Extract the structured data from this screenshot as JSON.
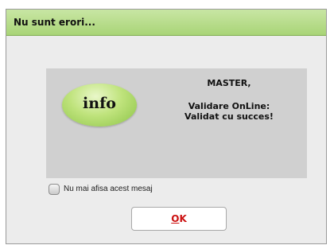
{
  "dialog": {
    "title": "Nu sunt erori...",
    "info_label": "info",
    "message": {
      "user": "MASTER,",
      "line1": "Validare OnLine:",
      "line2": "Validat cu succes!"
    },
    "checkbox": {
      "label": "Nu mai afisa acest mesaj",
      "checked": false
    },
    "ok_button": {
      "mnemonic": "O",
      "rest": "K"
    }
  },
  "colors": {
    "titlebar": "#b5da89",
    "panel": "#d0d0d0",
    "info_badge": "#a9d561",
    "ok_text": "#cc1111"
  },
  "icons": {
    "info_badge": "info-badge-icon"
  }
}
